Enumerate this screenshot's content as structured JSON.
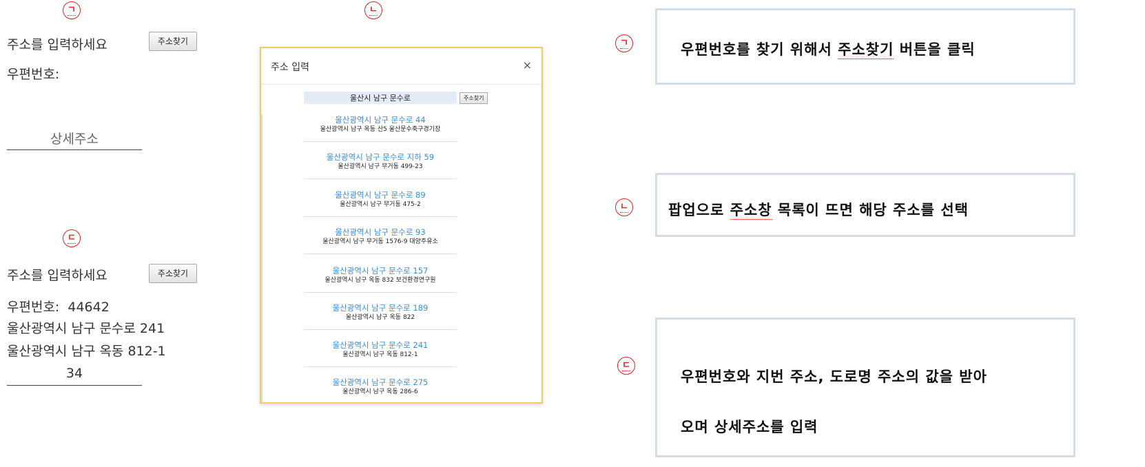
{
  "markers": {
    "a": "ㄱ",
    "b": "ㄴ",
    "c": "ㄷ"
  },
  "form_before": {
    "prompt": "주소를 입력하세요",
    "find_button": "주소찾기",
    "zipcode_label": "우편번호:",
    "detail_placeholder": "상세주소"
  },
  "modal": {
    "title": "주소 입력",
    "close": "×",
    "search_value": "울산시 남구 문수로",
    "search_button": "주소찾기",
    "results": [
      {
        "road": "울산광역시 남구 문수로 44",
        "jibun": "울산광역시 남구 옥동 산5 울산문수축구경기장"
      },
      {
        "road": "울산광역시 남구 문수로 지하 59",
        "jibun": "울산광역시 남구 무거동 499-23"
      },
      {
        "road": "울산광역시 남구 문수로 89",
        "jibun": "울산광역시 남구 무거동 475-2"
      },
      {
        "road": "울산광역시 남구 문수로 93",
        "jibun": "울산광역시 남구 무거동 1576-9 대양주유소"
      },
      {
        "road": "울산광역시 남구 문수로 157",
        "jibun": "울산광역시 남구 옥동 832 보건환경연구원"
      },
      {
        "road": "울산광역시 남구 문수로 189",
        "jibun": "울산광역시 남구 옥동 822"
      },
      {
        "road": "울산광역시 남구 문수로 241",
        "jibun": "울산광역시 남구 옥동 812-1"
      },
      {
        "road": "울산광역시 남구 문수로 275",
        "jibun": "울산광역시 남구 옥동 286-6"
      }
    ]
  },
  "form_after": {
    "prompt": "주소를 입력하세요",
    "find_button": "주소찾기",
    "zipcode_label": "우편번호:",
    "zipcode_value": "44642",
    "road_address": "울산광역시 남구 문수로 241",
    "jibun_address": "울산광역시 남구 옥동 812-1",
    "detail_value": "34"
  },
  "explanations": {
    "step1": {
      "before": "우편번호를 찾기 위해서 ",
      "highlight": "주소찾기",
      "after": " 버튼을 클릭"
    },
    "step2": {
      "before": "팝업으로 ",
      "highlight": "주소창",
      "after": " 목록이 뜨면 해당 주소를 선택"
    },
    "step3": {
      "line1": "우편번호와 지번 주소, 도로명 주소의 값을 받아",
      "line2": "오며 상세주소를 입력"
    }
  },
  "colors": {
    "marker": "#e0241b",
    "link_blue": "#3b8ed6",
    "modal_border": "#f2cd5a",
    "box_border": "#d3dcec"
  }
}
